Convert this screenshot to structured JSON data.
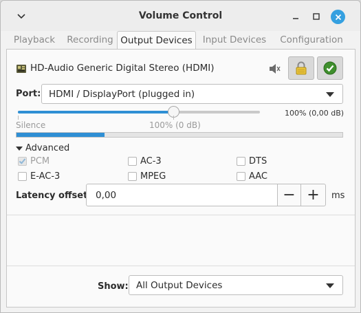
{
  "window": {
    "title": "Volume Control"
  },
  "tabs": [
    {
      "label": "Playback",
      "active": false
    },
    {
      "label": "Recording",
      "active": false
    },
    {
      "label": "Output Devices",
      "active": true
    },
    {
      "label": "Input Devices",
      "active": false
    },
    {
      "label": "Configuration",
      "active": false
    }
  ],
  "device": {
    "name": "HD-Audio Generic Digital Stereo (HDMI)",
    "port_label": "Port:",
    "port_value": "HDMI / DisplayPort (plugged in)",
    "volume_percent": 100,
    "volume_readout": "100% (0,00 dB)",
    "scale_silence": "Silence",
    "scale_100": "100% (0 dB)",
    "peak_level": 0.27,
    "advanced_label": "Advanced",
    "formats": [
      {
        "label": "PCM",
        "checked": true,
        "enabled": false
      },
      {
        "label": "AC-3",
        "checked": false,
        "enabled": true
      },
      {
        "label": "DTS",
        "checked": false,
        "enabled": true
      },
      {
        "label": "E-AC-3",
        "checked": false,
        "enabled": true
      },
      {
        "label": "MPEG",
        "checked": false,
        "enabled": true
      },
      {
        "label": "AAC",
        "checked": false,
        "enabled": true
      }
    ],
    "latency_label": "Latency offset:",
    "latency_value": "0,00",
    "latency_unit": "ms",
    "minus": "−",
    "plus": "+"
  },
  "footer": {
    "show_label": "Show:",
    "show_value": "All Output Devices"
  },
  "colors": {
    "accent": "#2f8fd4",
    "close": "#35a0e0"
  }
}
